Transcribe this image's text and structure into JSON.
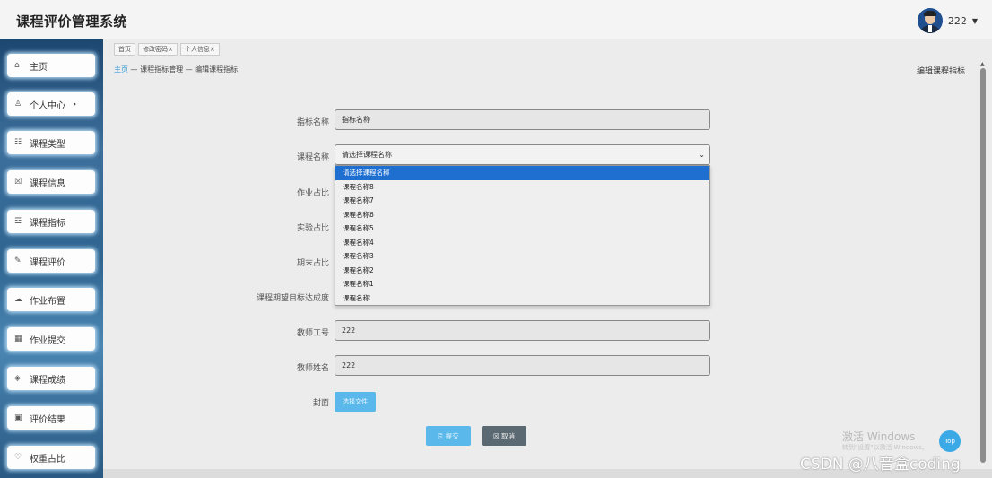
{
  "app": {
    "title": "课程评价管理系统"
  },
  "user": {
    "name": "222",
    "caret": "▼"
  },
  "sidebar": {
    "items": [
      {
        "icon": "⌂",
        "label": "主页"
      },
      {
        "icon": "♙",
        "label": "个人中心",
        "arrow": "›"
      },
      {
        "icon": "☷",
        "label": "课程类型"
      },
      {
        "icon": "☒",
        "label": "课程信息"
      },
      {
        "icon": "☲",
        "label": "课程指标"
      },
      {
        "icon": "✎",
        "label": "课程评价"
      },
      {
        "icon": "☁",
        "label": "作业布置"
      },
      {
        "icon": "▦",
        "label": "作业提交"
      },
      {
        "icon": "◈",
        "label": "课程成绩"
      },
      {
        "icon": "▣",
        "label": "评价结果"
      },
      {
        "icon": "♡",
        "label": "权重占比"
      }
    ]
  },
  "tabs": [
    "首页",
    "修改密码×",
    "个人信息×"
  ],
  "breadcrumb": {
    "home": "主页",
    "rest": " — 课程指标管理 — 编辑课程指标"
  },
  "page_heading": "编辑课程指标",
  "form": {
    "indicator_label": "指标名称",
    "indicator_value": "指标名称",
    "course_label": "课程名称",
    "course_value": "请选择课程名称",
    "homework_label": "作业占比",
    "lab_label": "实验占比",
    "final_label": "期末占比",
    "target_label": "课程期望目标达成度",
    "teacher_id_label": "教师工号",
    "teacher_id_value": "222",
    "teacher_name_label": "教师姓名",
    "teacher_name_value": "222",
    "cover_label": "封面",
    "file_button": "选择文件",
    "submit_button": "⎘ 提交",
    "cancel_button": "☒ 取消"
  },
  "dropdown_options": [
    "请选择课程名称",
    "课程名称8",
    "课程名称7",
    "课程名称6",
    "课程名称5",
    "课程名称4",
    "课程名称3",
    "课程名称2",
    "课程名称1",
    "课程名称"
  ],
  "overlay": {
    "activate_windows": "激活 Windows",
    "activate_hint": "转到\"设置\"以激活 Windows。",
    "top_button": "Top",
    "csdn": "CSDN @八音盒coding"
  }
}
